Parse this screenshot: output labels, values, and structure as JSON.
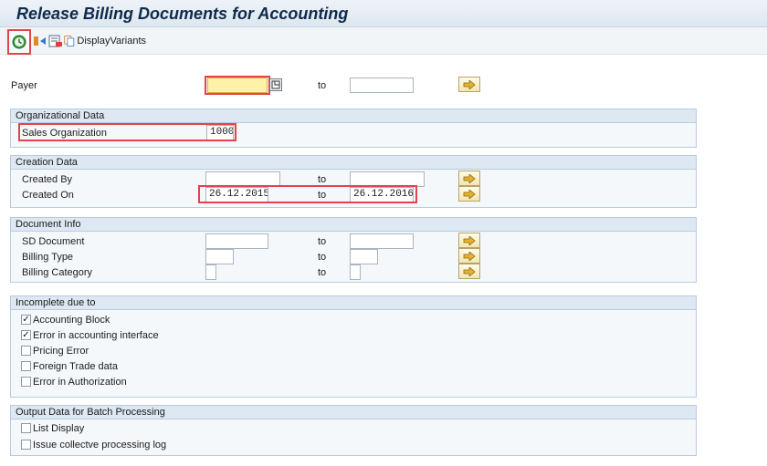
{
  "title": "Release Billing Documents for Accounting",
  "toolbar": {
    "execute_icon": "execute-clock-icon",
    "variants_label": "DisplayVariants"
  },
  "payer": {
    "label": "Payer",
    "value": "",
    "to": "to",
    "to_value": ""
  },
  "org": {
    "heading": "Organizational Data",
    "sales_org_label": "Sales Organization",
    "sales_org_value": "1000"
  },
  "creation": {
    "heading": "Creation Data",
    "created_by_label": "Created By",
    "created_by_value": "",
    "created_on_label": "Created On",
    "created_on_from": "26.12.2015",
    "created_on_to": "26.12.2016",
    "to": "to"
  },
  "docinfo": {
    "heading": "Document Info",
    "sd_label": "SD Document",
    "billing_type_label": "Billing Type",
    "billing_cat_label": "Billing Category",
    "to": "to"
  },
  "incomplete": {
    "heading": "Incomplete due to",
    "items": [
      {
        "label": "Accounting Block",
        "checked": true
      },
      {
        "label": "Error in accounting interface",
        "checked": true
      },
      {
        "label": "Pricing Error",
        "checked": false
      },
      {
        "label": "Foreign Trade data",
        "checked": false
      },
      {
        "label": "Error in Authorization",
        "checked": false
      }
    ]
  },
  "output": {
    "heading": "Output Data for Batch Processing",
    "items": [
      {
        "label": "List Display",
        "checked": false
      },
      {
        "label": "Issue collectve processing log",
        "checked": false
      }
    ]
  },
  "colors": {
    "highlight": "#e0454a",
    "focus_field": "#fff2a8",
    "group_header": "#dde8f3"
  }
}
